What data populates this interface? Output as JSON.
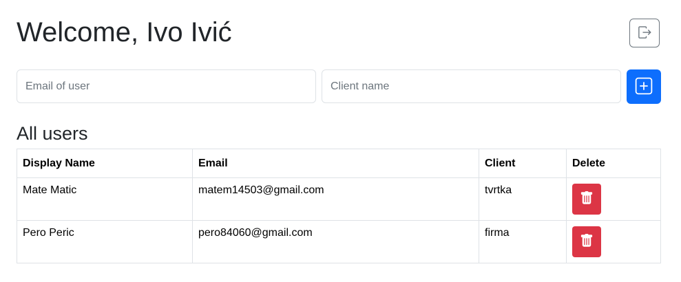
{
  "header": {
    "welcome_text": "Welcome, Ivo Ivić",
    "logout_icon": "logout-icon"
  },
  "form": {
    "email_placeholder": "Email of user",
    "email_value": "",
    "client_placeholder": "Client name",
    "client_value": "",
    "add_icon": "plus-square-icon"
  },
  "users": {
    "title": "All users",
    "columns": [
      "Display Name",
      "Email",
      "Client",
      "Delete"
    ],
    "rows": [
      {
        "display_name": "Mate Matic",
        "email": "matem14503@gmail.com",
        "client": "tvrtka"
      },
      {
        "display_name": "Pero Peric",
        "email": "pero84060@gmail.com",
        "client": "firma"
      }
    ]
  },
  "colors": {
    "primary": "#0d6efd",
    "danger": "#dc3545",
    "secondary": "#6c757d"
  }
}
